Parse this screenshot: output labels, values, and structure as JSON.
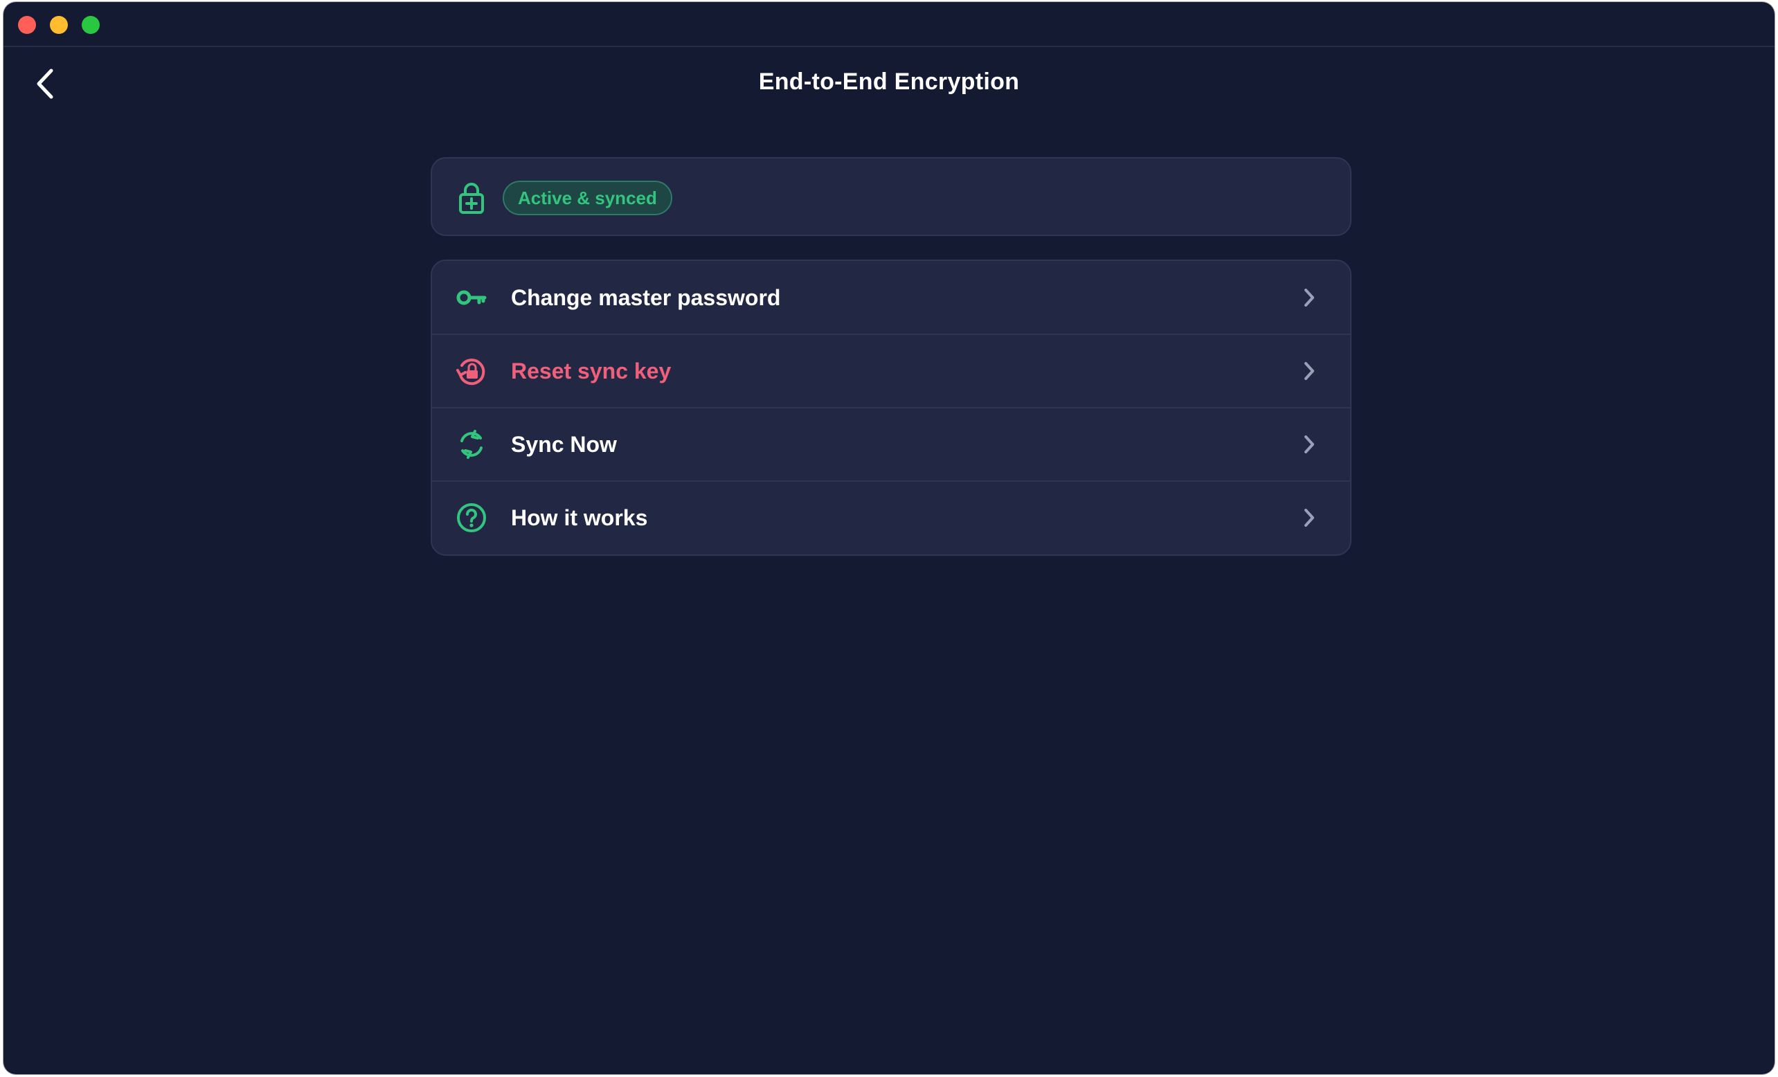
{
  "window": {
    "controls": [
      "close",
      "minimize",
      "zoom"
    ]
  },
  "header": {
    "title": "End-to-End Encryption",
    "back_icon": "chevron-left-icon"
  },
  "status": {
    "icon": "lock-plus-icon",
    "badge": "Active & synced",
    "badge_color": "#33c47e"
  },
  "menu": {
    "items": [
      {
        "label": "Change master password",
        "icon": "key-icon",
        "color": "#ffffff"
      },
      {
        "label": "Reset sync key",
        "icon": "lock-reset-icon",
        "color": "#f0607b"
      },
      {
        "label": "Sync Now",
        "icon": "sync-icon",
        "color": "#ffffff"
      },
      {
        "label": "How it works",
        "icon": "help-circle-icon",
        "color": "#ffffff"
      }
    ]
  },
  "colors": {
    "background": "#151a33",
    "card": "#222744",
    "accent_green": "#33c47e",
    "danger": "#f0607b"
  }
}
